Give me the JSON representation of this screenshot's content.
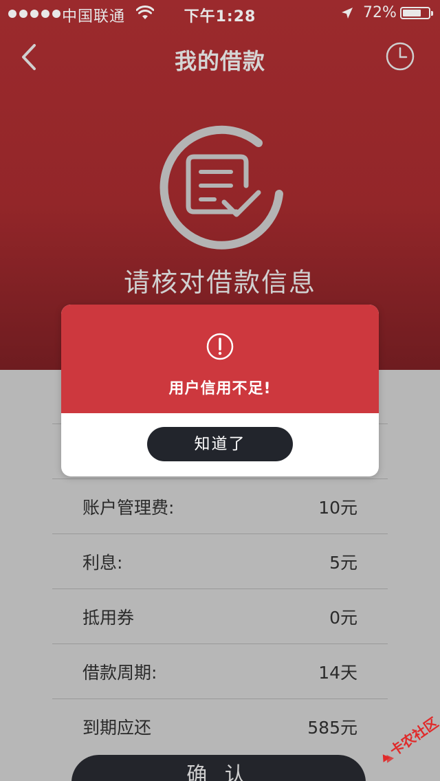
{
  "status_bar": {
    "carrier": "中国联通",
    "time": "下午1:28",
    "battery": "72%",
    "battery_level": 0.72
  },
  "nav": {
    "title": "我的借款",
    "back_icon": "chevron-left-icon",
    "right_icon": "clock-icon"
  },
  "hero": {
    "icon": "document-check-icon",
    "title": "请核对借款信息"
  },
  "details": [
    {
      "label": "账户管理费:",
      "value": "10元"
    },
    {
      "label": "利息:",
      "value": "5元"
    },
    {
      "label": "抵用券",
      "value": "0元"
    },
    {
      "label": "借款周期:",
      "value": "14天"
    },
    {
      "label": "到期应还",
      "value": "585元"
    }
  ],
  "confirm_label": "确 认",
  "modal": {
    "icon": "exclamation-circle-icon",
    "message": "用户信用不足!",
    "button_label": "知道了"
  },
  "watermark": {
    "text": "卡农社区"
  },
  "colors": {
    "header_red": "#9b2a2d",
    "modal_red": "#cd383e",
    "button_dark": "#22252c",
    "overlay_gray": "#b7b7b7"
  }
}
